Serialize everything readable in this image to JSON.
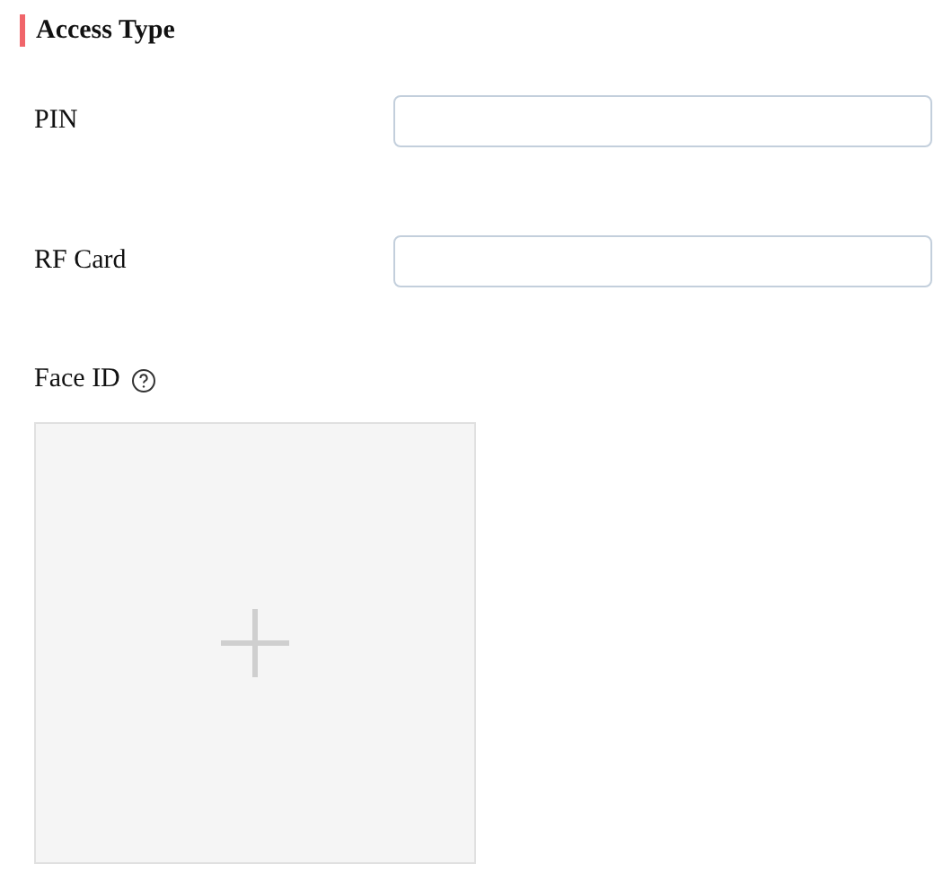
{
  "section": {
    "title": "Access Type"
  },
  "fields": [
    {
      "label": "PIN"
    },
    {
      "label": "RF Card"
    }
  ],
  "face_id": {
    "label": "Face ID"
  }
}
